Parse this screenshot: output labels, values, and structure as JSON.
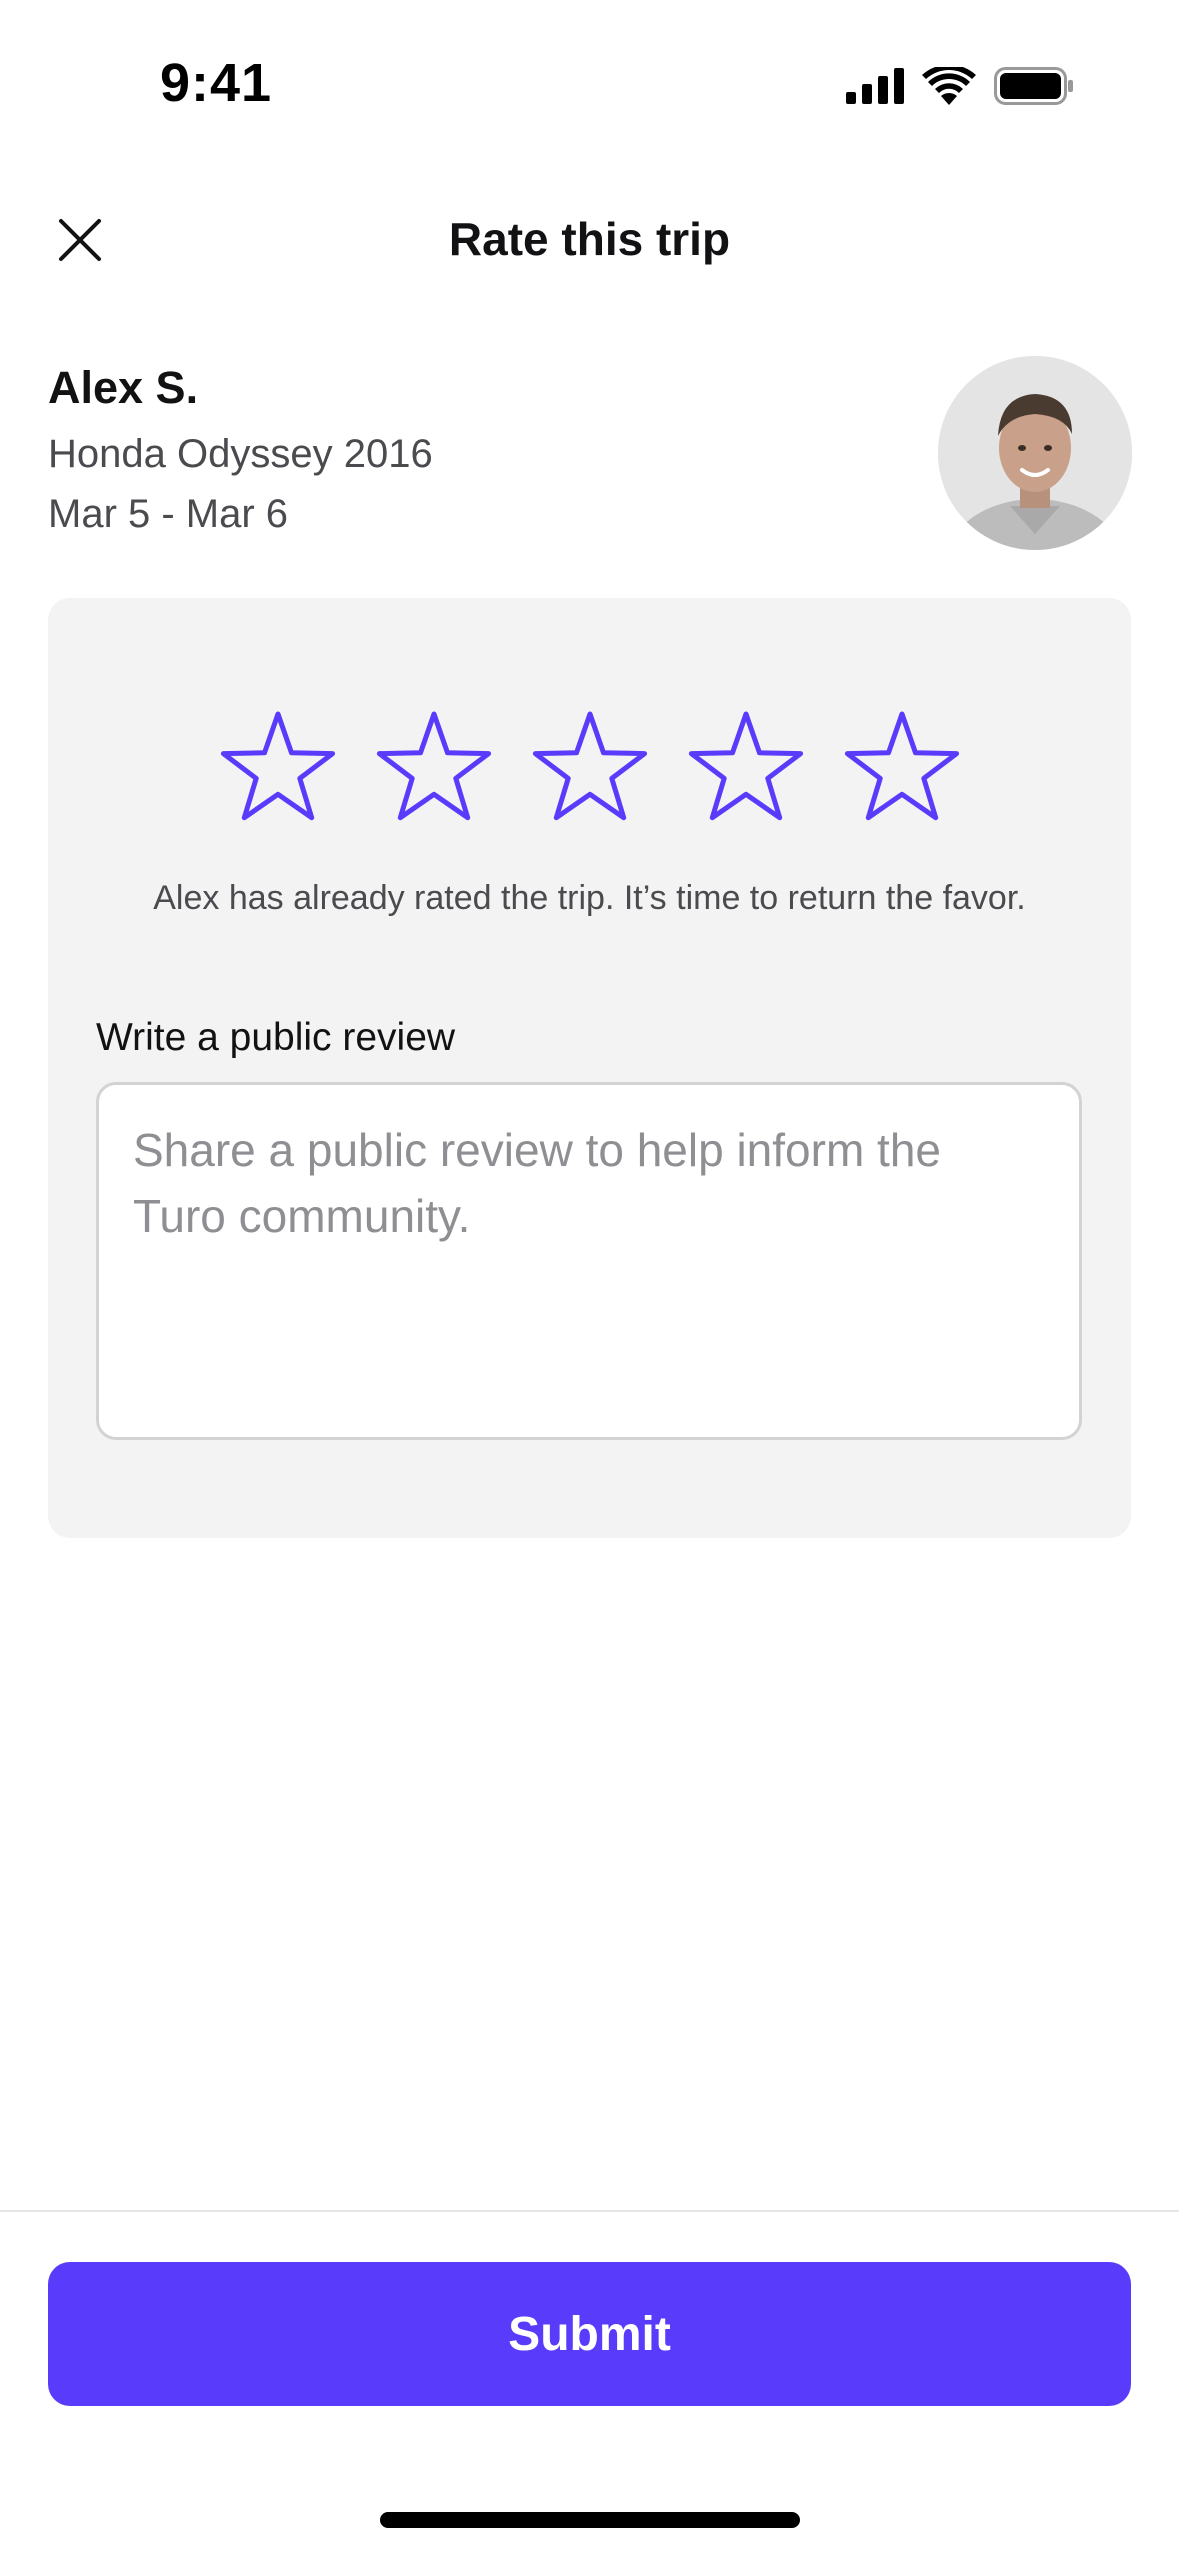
{
  "status_bar": {
    "time": "9:41",
    "icons": [
      "cellular-signal-icon",
      "wifi-icon",
      "battery-icon"
    ]
  },
  "header": {
    "title": "Rate this trip",
    "close_icon": "close-icon"
  },
  "trip": {
    "host_name": "Alex S.",
    "vehicle": "Honda Odyssey 2016",
    "dates": "Mar 5 - Mar 6"
  },
  "rating": {
    "max_stars": 5,
    "selected_stars": 0,
    "star_color": "#593cfb",
    "prompt": "Alex has already rated the trip. It’s time to return the favor."
  },
  "review": {
    "label": "Write a public review",
    "placeholder": "Share a public review to help inform the Turo community.",
    "value": ""
  },
  "footer": {
    "submit_label": "Submit"
  },
  "colors": {
    "accent": "#593cfb",
    "card_background": "#f3f3f3",
    "secondary_text": "#4a4a4f"
  }
}
